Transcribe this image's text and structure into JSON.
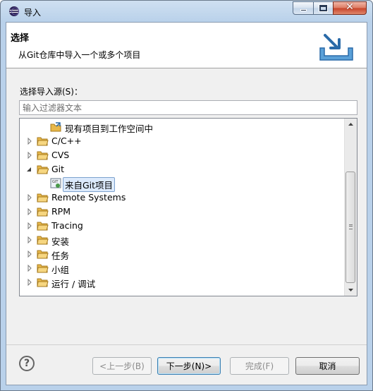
{
  "window": {
    "title": "导入"
  },
  "header": {
    "title": "选择",
    "description": "从Git仓库中导入一个或多个项目"
  },
  "source_label": "选择导入源(S)：",
  "filter": {
    "placeholder": "输入过滤器文本",
    "value": ""
  },
  "tree": {
    "items": [
      {
        "label": "现有项目到工作空间中",
        "level": 1,
        "expanded": null,
        "icon": "project-import-icon"
      },
      {
        "label": "C/C++",
        "level": 0,
        "expanded": false,
        "icon": "folder-icon"
      },
      {
        "label": "CVS",
        "level": 0,
        "expanded": false,
        "icon": "folder-icon"
      },
      {
        "label": "Git",
        "level": 0,
        "expanded": true,
        "icon": "folder-open-icon"
      },
      {
        "label": "来自Git项目",
        "level": 1,
        "expanded": null,
        "icon": "git-project-icon",
        "selected": true
      },
      {
        "label": "Remote Systems",
        "level": 0,
        "expanded": false,
        "icon": "folder-icon"
      },
      {
        "label": "RPM",
        "level": 0,
        "expanded": false,
        "icon": "folder-icon"
      },
      {
        "label": "Tracing",
        "level": 0,
        "expanded": false,
        "icon": "folder-icon"
      },
      {
        "label": "安装",
        "level": 0,
        "expanded": false,
        "icon": "folder-icon"
      },
      {
        "label": "任务",
        "level": 0,
        "expanded": false,
        "icon": "folder-icon"
      },
      {
        "label": "小组",
        "level": 0,
        "expanded": false,
        "icon": "folder-icon"
      },
      {
        "label": "运行 / 调试",
        "level": 0,
        "expanded": false,
        "icon": "folder-icon"
      }
    ]
  },
  "buttons": {
    "help": "?",
    "back": "<上一步(B)",
    "next": "下一步(N)>",
    "finish": "完成(F)",
    "cancel": "取消"
  },
  "colors": {
    "accent": "#3c7fb1",
    "folder": "#e8b84a",
    "selection": "#dceafc"
  }
}
